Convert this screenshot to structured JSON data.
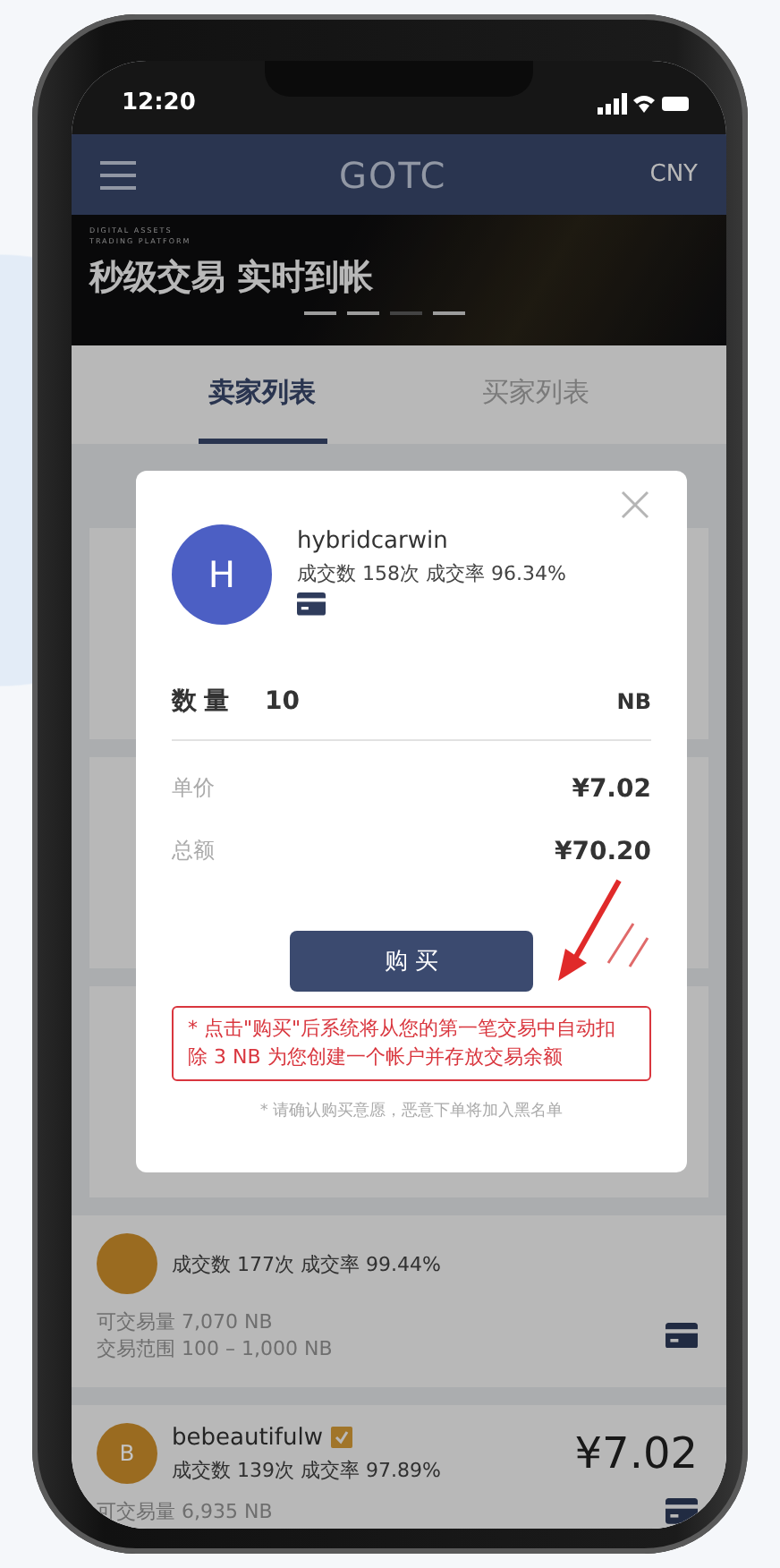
{
  "status_bar": {
    "time": "12:20"
  },
  "header": {
    "logo": "GOTC",
    "currency": "CNY"
  },
  "banner": {
    "caption_lines": [
      "DIGITAL ASSETS",
      "TRADING PLATFORM"
    ],
    "headline": "秒级交易 实时到帐",
    "slides": [
      {
        "selected": false
      },
      {
        "selected": false
      },
      {
        "selected": true
      },
      {
        "selected": false
      }
    ]
  },
  "tabs": [
    {
      "label": "卖家列表",
      "selected": true
    },
    {
      "label": "买家列表",
      "selected": false
    }
  ],
  "sellers": [
    {
      "color": "#9a6b20",
      "stats": "成交数 177次 成交率 99.44%",
      "volume": "可交易量 7,070 NB",
      "range": "交易范围 100 – 1,000 NB"
    },
    {
      "avatar": "B",
      "color": "#9a6b20",
      "name": "bebeautifulw",
      "verified": true,
      "stats": "成交数 139次 成交率 97.89%",
      "price": "¥7.02",
      "volume": "可交易量 6,935 NB"
    }
  ],
  "dialog": {
    "avatar": "H",
    "color": "#4c5fc4",
    "name": "hybridcarwin",
    "stats": "成交数 158次 成交率 96.34%",
    "quantity": {
      "label": "数量",
      "value": "10",
      "unit": "NB"
    },
    "rows": [
      {
        "label": "单价",
        "value": "¥7.02"
      },
      {
        "label": "总额",
        "value": "¥70.20"
      }
    ],
    "button": "购 买",
    "notice": "* 点击\"购买\"后系统将从您的第一笔交易中自动扣除 3 NB 为您创建一个帐户并存放交易余额",
    "note": "* 请确认购买意愿，恶意下单将加入黑名单"
  }
}
